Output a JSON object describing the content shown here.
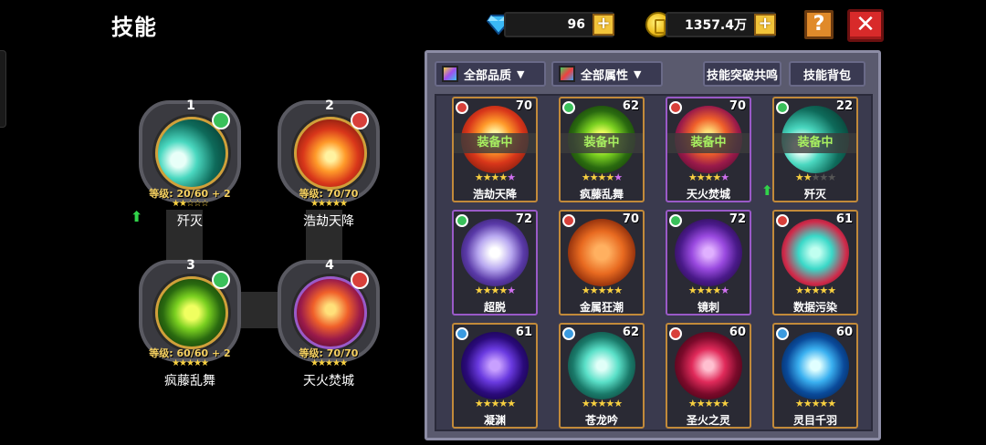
{
  "header": {
    "title": "技能"
  },
  "currency": {
    "gems": "96",
    "gold": "1357.4万",
    "plus_label": "+"
  },
  "buttons": {
    "help": "?",
    "close": "✕"
  },
  "equipped": [
    {
      "slot": "1",
      "name": "歼灭",
      "level": "等级: 20/60 + 2",
      "stars": "★★☆☆☆",
      "element": "green"
    },
    {
      "slot": "2",
      "name": "浩劫天降",
      "level": "等级: 70/70",
      "stars": "★★★★★",
      "element": "red"
    },
    {
      "slot": "3",
      "name": "疯藤乱舞",
      "level": "等级: 60/60 + 2",
      "stars": "★★★★★",
      "element": "green"
    },
    {
      "slot": "4",
      "name": "天火焚城",
      "level": "等级: 70/70",
      "stars": "★★★★★",
      "element": "red"
    }
  ],
  "toolbar": {
    "quality_filter": "全部品质",
    "attribute_filter": "全部属性",
    "resonance": "技能突破共鸣",
    "bag": "技能背包"
  },
  "equipped_badge": "装备中",
  "skills": [
    {
      "name": "浩劫天降",
      "level": "70",
      "equipped": true,
      "element": "red"
    },
    {
      "name": "疯藤乱舞",
      "level": "62",
      "equipped": true,
      "element": "green"
    },
    {
      "name": "天火焚城",
      "level": "70",
      "equipped": true,
      "element": "red"
    },
    {
      "name": "歼灭",
      "level": "22",
      "equipped": true,
      "element": "green"
    },
    {
      "name": "超脱",
      "level": "72",
      "equipped": false,
      "element": "green"
    },
    {
      "name": "金属狂潮",
      "level": "70",
      "equipped": false,
      "element": "red"
    },
    {
      "name": "镜刺",
      "level": "72",
      "equipped": false,
      "element": "green"
    },
    {
      "name": "数据污染",
      "level": "61",
      "equipped": false,
      "element": "red"
    },
    {
      "name": "凝渊",
      "level": "61",
      "equipped": false,
      "element": "blue"
    },
    {
      "name": "苍龙吟",
      "level": "62",
      "equipped": false,
      "element": "blue"
    },
    {
      "name": "圣火之灵",
      "level": "60",
      "equipped": false,
      "element": "red"
    },
    {
      "name": "灵目千羽",
      "level": "60",
      "equipped": false,
      "element": "blue"
    }
  ],
  "colors": {
    "accent_gold": "#f2c43a",
    "close_red": "#d82a2a",
    "equipped_text": "#a8f060"
  }
}
